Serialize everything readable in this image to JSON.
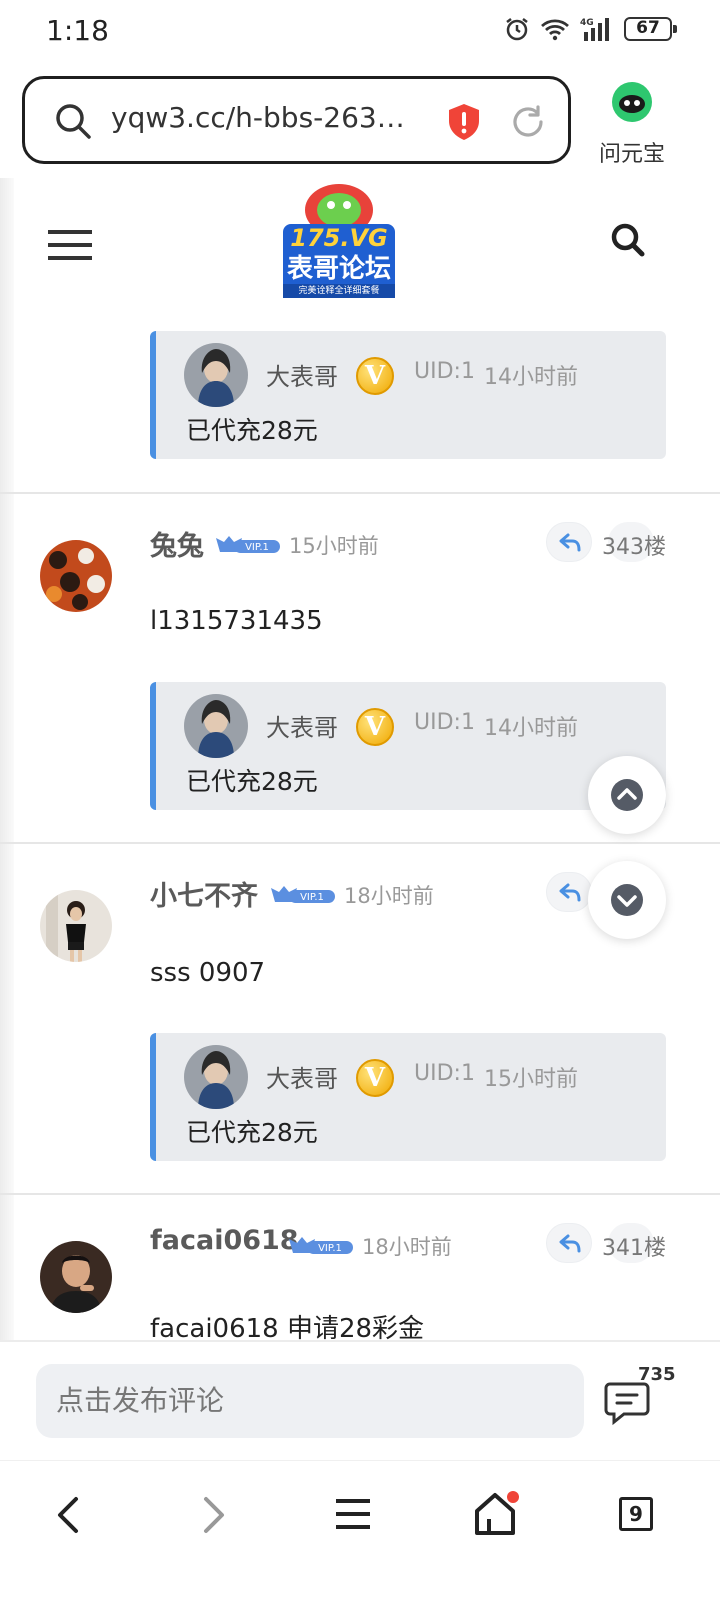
{
  "status_bar": {
    "time": "1:18",
    "battery": "67",
    "network": "4G"
  },
  "browser": {
    "url": "yqw3.cc/h-bbs-2637....",
    "assistant_label": "问元宝"
  },
  "site": {
    "logo_line1": "175.VG",
    "logo_line2": "表哥论坛",
    "logo_tagline": "完美诠释全详细套餐"
  },
  "posts": [
    {
      "quote": {
        "name": "大表哥",
        "badge": "V",
        "uid": "UID:1",
        "time": "14小时前",
        "text": "已代充28元"
      }
    },
    {
      "username": "兔兔",
      "vip": "VIP.1",
      "time": "15小时前",
      "floor": "343楼",
      "content": "l1315731435",
      "quote": {
        "name": "大表哥",
        "badge": "V",
        "uid": "UID:1",
        "time": "14小时前",
        "text": "已代充28元"
      }
    },
    {
      "username": "小七不齐",
      "vip": "VIP.1",
      "time": "18小时前",
      "floor": "",
      "content": "sss 0907",
      "quote": {
        "name": "大表哥",
        "badge": "V",
        "uid": "UID:1",
        "time": "15小时前",
        "text": "已代充28元"
      }
    },
    {
      "username": "facai0618",
      "vip": "VIP.1",
      "time": "18小时前",
      "floor": "341楼",
      "content": "facai0618 申请28彩金"
    }
  ],
  "comment_bar": {
    "placeholder": "点击发布评论",
    "count": "735"
  },
  "bottom_nav": {
    "tab_count": "9"
  },
  "colors": {
    "accent": "#4a90e2",
    "quote_bg": "#e9ebee",
    "vip": "#5b8fe0",
    "badge_gold": "#f0a800",
    "notification": "#f04438"
  }
}
